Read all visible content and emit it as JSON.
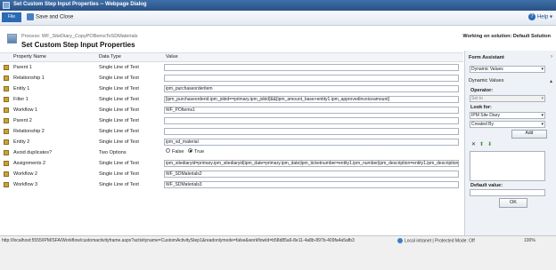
{
  "window": {
    "title": "Set Custom Step Input Properties -- Webpage Dialog"
  },
  "ribbon": {
    "file_label": "File",
    "save_close_label": "Save and Close",
    "help_label": "Help"
  },
  "header": {
    "process": "Process: WF_SiteDiary_CopyPOBemsToSDMaterials",
    "title": "Set Custom Step Input Properties",
    "solution": "Working on solution: Default Solution"
  },
  "grid": {
    "columns": [
      "Property Name",
      "Data Type",
      "Value"
    ],
    "rows": [
      {
        "name": "Parent 1",
        "type": "Single Line of Text",
        "value": ""
      },
      {
        "name": "Relationship 1",
        "type": "Single Line of Text",
        "value": ""
      },
      {
        "name": "Entity 1",
        "type": "Single Line of Text",
        "value": "ipm_purchaseorderitem"
      },
      {
        "name": "Filter 1",
        "type": "Single Line of Text",
        "value": "[ipm_purchaseorderid.ipm_jobid==primary.ipm_jobid]&&[ipm_amount_base>entity1.ipm_approvedinvoiceamount]"
      },
      {
        "name": "Workflow 1",
        "type": "Single Line of Text",
        "value": "WF_POItems1"
      },
      {
        "name": "Parent 2",
        "type": "Single Line of Text",
        "value": ""
      },
      {
        "name": "Relationship 2",
        "type": "Single Line of Text",
        "value": ""
      },
      {
        "name": "Entity 2",
        "type": "Single Line of Text",
        "value": "ipm_sd_material"
      },
      {
        "name": "Avoid duplicates?",
        "type": "Two Options",
        "value": ""
      },
      {
        "name": "Assignments 2",
        "type": "Single Line of Text",
        "value": "ipm_sitediaryid=primary.ipm_sitediaryid|ipm_date=primary.ipm_date|ipm_ticketnumber=entity1.ipm_number|ipm_description=entity1.ipm_description"
      },
      {
        "name": "Workflow 2",
        "type": "Single Line of Text",
        "value": "WF_SDMaterials2"
      },
      {
        "name": "Workflow 3",
        "type": "Single Line of Text",
        "value": "WF_SDMaterials3"
      }
    ],
    "radio_false": "False",
    "radio_true": "True"
  },
  "side": {
    "form_assistant": "Form Assistant",
    "dynamic_values_select": "Dynamic Values",
    "dynamic_values_section": "Dynamic Values",
    "operator_label": "Operator:",
    "operator_value": "Set to",
    "look_for_label": "Look for:",
    "look_for_entity": "IPM Site Diary",
    "look_for_field": "Created By",
    "add_label": "Add",
    "default_value_label": "Default value:",
    "ok_label": "OK"
  },
  "status": {
    "url": "http://localhost:5555/IPM/SFA/Workflow/customactivityframe.aspx?activityname=CustomActivityStep1&readonlymode=false&workflowId=b58d85a6-8e11-4a8b-897b-409fa4a5afb3",
    "zone": "Local intranet | Protected Mode: Off",
    "zoom": "100%"
  }
}
